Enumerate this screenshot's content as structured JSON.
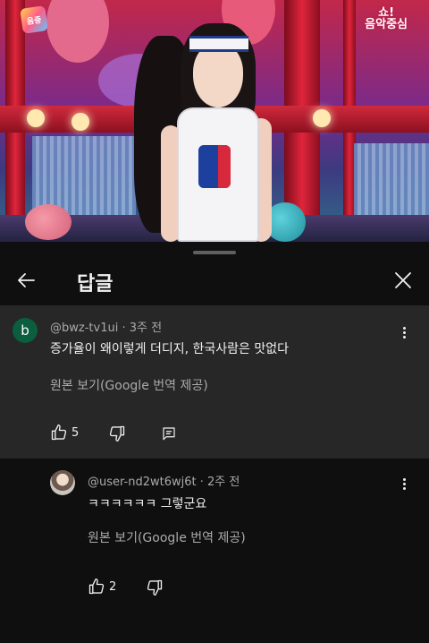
{
  "video": {
    "watermark_left": "음중",
    "watermark_right": "쇼!\n음악중심"
  },
  "sheet": {
    "title": "답글",
    "back_icon": "arrow-left-icon",
    "close_icon": "close-icon"
  },
  "parent_comment": {
    "avatar_letter": "b",
    "avatar_color": "#0b5e3e",
    "author": "@bwz-tv1ui",
    "time": "· 3주 전",
    "text": "증가율이 왜이렇게 더디지, 한국사람은 맛없다",
    "translate_label": "원본 보기(Google 번역 제공)",
    "likes": "5"
  },
  "reply": {
    "author": "@user-nd2wt6wj6t",
    "time": "· 2주 전",
    "text": "ㅋㅋㅋㅋㅋㅋ 그렇군요",
    "translate_label": "원본 보기(Google 번역 제공)",
    "likes": "2"
  }
}
